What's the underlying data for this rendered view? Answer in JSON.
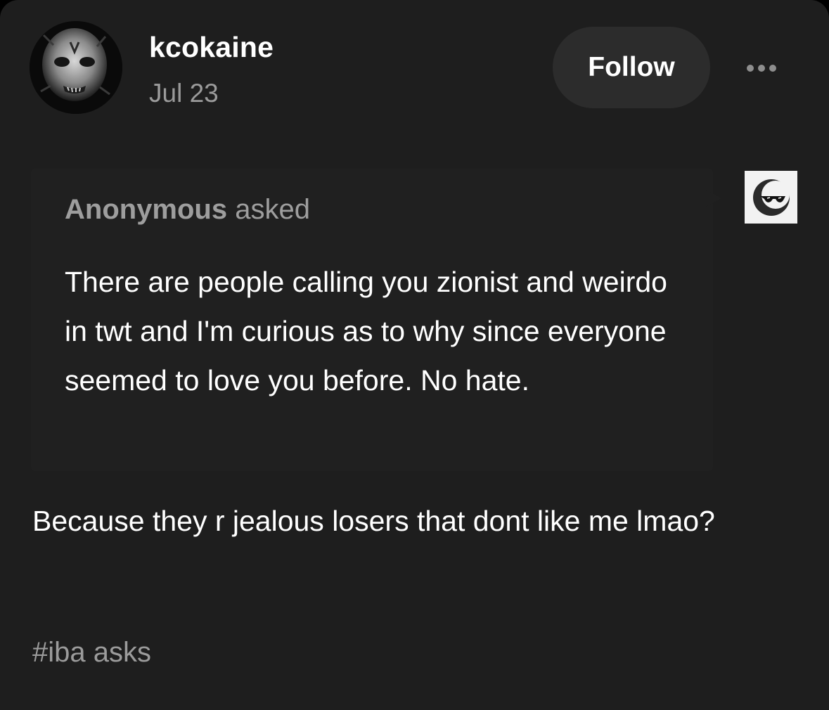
{
  "post": {
    "username": "kcokaine",
    "date": "Jul 23",
    "follow_label": "Follow",
    "more_icon": "ellipsis-icon",
    "ask": {
      "asker": "Anonymous",
      "asked_label": "asked",
      "question": "There are people calling you zionist and weirdo in twt and I'm curious as to why since everyone seemed to love you before. No hate.",
      "avatar_icon": "anonymous-sunglasses-icon"
    },
    "answer": "Because they r jealous losers that dont like me lmao?",
    "tags": [
      "#iba asks"
    ]
  },
  "colors": {
    "background": "#1e1e1e",
    "ask_background": "#202020",
    "text_primary": "#ffffff",
    "text_secondary": "#9b9b9b",
    "follow_button": "#2c2c2c"
  }
}
